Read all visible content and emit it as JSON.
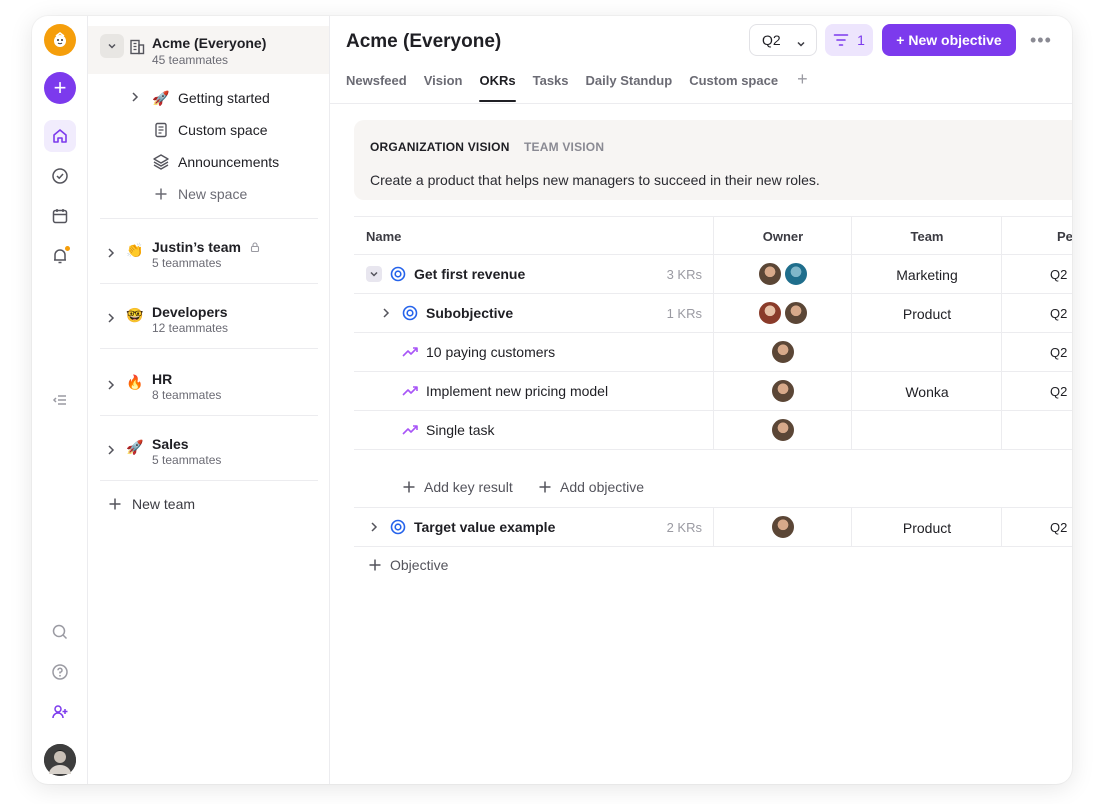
{
  "rail": {
    "icons": [
      "logo-icon",
      "plus-icon",
      "home-icon",
      "check-circle-icon",
      "calendar-icon",
      "bell-icon",
      "collapse-sidebar-icon",
      "search-icon",
      "help-icon",
      "add-user-icon"
    ]
  },
  "sidebar": {
    "workspace": {
      "title": "Acme (Everyone)",
      "subtitle": "45 teammates"
    },
    "spaces": [
      {
        "label": "Getting started",
        "emoji": "🚀"
      },
      {
        "label": "Custom space"
      },
      {
        "label": "Announcements"
      },
      {
        "label": "New space"
      }
    ],
    "teams": [
      {
        "name": "Justin’s team",
        "sub": "5 teammates",
        "emoji": "👏"
      },
      {
        "name": "Developers",
        "sub": "12 teammates",
        "emoji": "🤓"
      },
      {
        "name": "HR",
        "sub": "8 teammates",
        "emoji": "🔥"
      },
      {
        "name": "Sales",
        "sub": "5 teammates",
        "emoji": "🚀"
      }
    ],
    "new_team": "New team"
  },
  "header": {
    "title": "Acme (Everyone)",
    "quarter": "Q2",
    "filter_count": "1",
    "new_objective": "+ New objective"
  },
  "tabs": [
    "Newsfeed",
    "Vision",
    "OKRs",
    "Tasks",
    "Daily Standup",
    "Custom space"
  ],
  "active_tab": "OKRs",
  "vision": {
    "tab_org": "ORGANIZATION VISION",
    "tab_team": "TEAM VISION",
    "text": "Create a product that helps new managers to succeed in their new roles."
  },
  "table": {
    "columns": [
      "Name",
      "Owner",
      "Team",
      "Pe"
    ],
    "rows": [
      {
        "name": "Get first revenue",
        "krs": "3 KRs",
        "team": "Marketing",
        "period": "Q2"
      },
      {
        "name": "Subobjective",
        "krs": "1 KRs",
        "team": "Product",
        "period": "Q2"
      },
      {
        "name": "10 paying customers",
        "krs": "",
        "team": "",
        "period": "Q2"
      },
      {
        "name": "Implement new pricing model",
        "krs": "",
        "team": "Wonka",
        "period": "Q2"
      },
      {
        "name": "Single task",
        "krs": "",
        "team": "",
        "period": ""
      },
      {
        "name": "Target value example",
        "krs": "2 KRs",
        "team": "Product",
        "period": "Q2"
      }
    ],
    "add_key_result": "Add key result",
    "add_objective": "Add objective",
    "objective": "Objective"
  },
  "colors": {
    "accent": "#7c3aed",
    "accent_soft": "#ede5fd",
    "objective_icon": "#2563eb",
    "kr_icon": "#a855f7",
    "logo": "#f59e0b"
  }
}
